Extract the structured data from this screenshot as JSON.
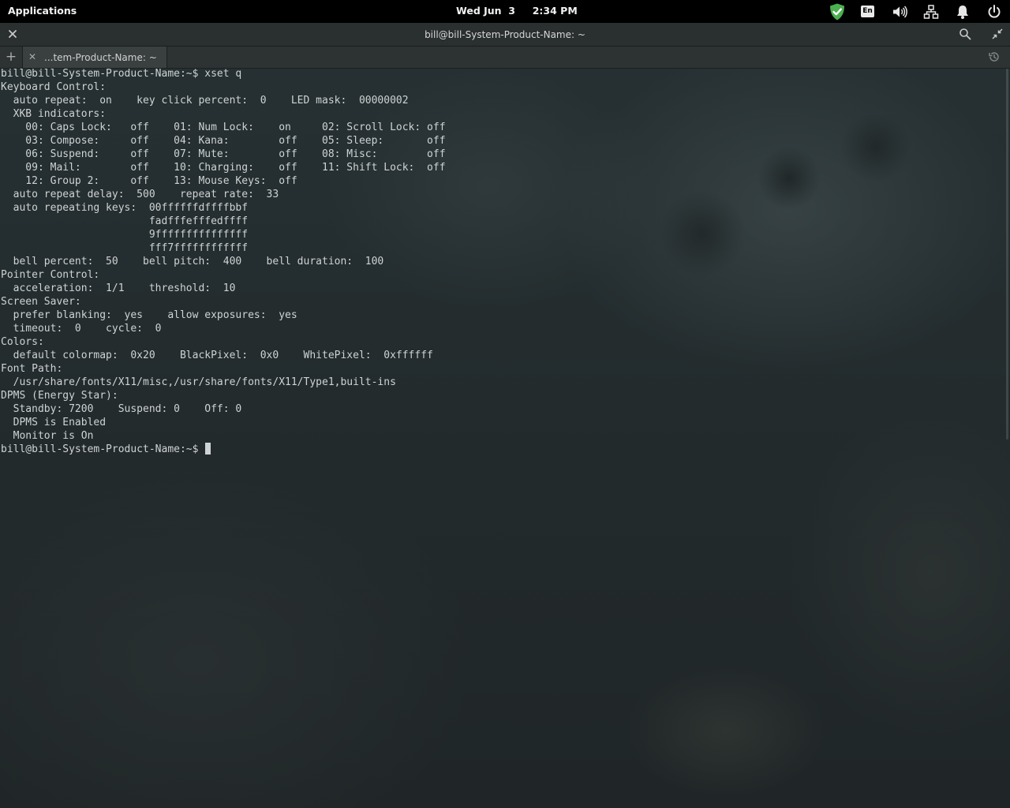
{
  "panel": {
    "applications_label": "Applications",
    "clock": "Wed Jun  3     2:34 PM",
    "keyboard_layout": "En",
    "icons": [
      "check-shield-icon",
      "keyboard-layout-icon",
      "volume-icon",
      "network-icon",
      "notification-bell-icon",
      "power-icon"
    ],
    "accent_green": "#4caf50"
  },
  "window": {
    "title": "bill@bill-System-Product-Name: ~",
    "tab_label": "...tem-Product-Name: ~",
    "icons": [
      "close-icon",
      "search-icon",
      "unmaximize-icon",
      "add-tab-icon",
      "history-icon"
    ]
  },
  "terminal": {
    "lines": [
      "bill@bill-System-Product-Name:~$ xset q",
      "Keyboard Control:",
      "  auto repeat:  on    key click percent:  0    LED mask:  00000002",
      "  XKB indicators:",
      "    00: Caps Lock:   off    01: Num Lock:    on     02: Scroll Lock: off",
      "    03: Compose:     off    04: Kana:        off    05: Sleep:       off",
      "    06: Suspend:     off    07: Mute:        off    08: Misc:        off",
      "    09: Mail:        off    10: Charging:    off    11: Shift Lock:  off",
      "    12: Group 2:     off    13: Mouse Keys:  off",
      "  auto repeat delay:  500    repeat rate:  33",
      "  auto repeating keys:  00ffffffdffffbbf",
      "                        fadfffefffedffff",
      "                        9fffffffffffffff",
      "                        fff7ffffffffffff",
      "  bell percent:  50    bell pitch:  400    bell duration:  100",
      "Pointer Control:",
      "  acceleration:  1/1    threshold:  10",
      "Screen Saver:",
      "  prefer blanking:  yes    allow exposures:  yes",
      "  timeout:  0    cycle:  0",
      "Colors:",
      "  default colormap:  0x20    BlackPixel:  0x0    WhitePixel:  0xffffff",
      "Font Path:",
      "  /usr/share/fonts/X11/misc,/usr/share/fonts/X11/Type1,built-ins",
      "DPMS (Energy Star):",
      "  Standby: 7200    Suspend: 0    Off: 0",
      "  DPMS is Enabled",
      "  Monitor is On"
    ],
    "prompt": "bill@bill-System-Product-Name:~$ "
  }
}
